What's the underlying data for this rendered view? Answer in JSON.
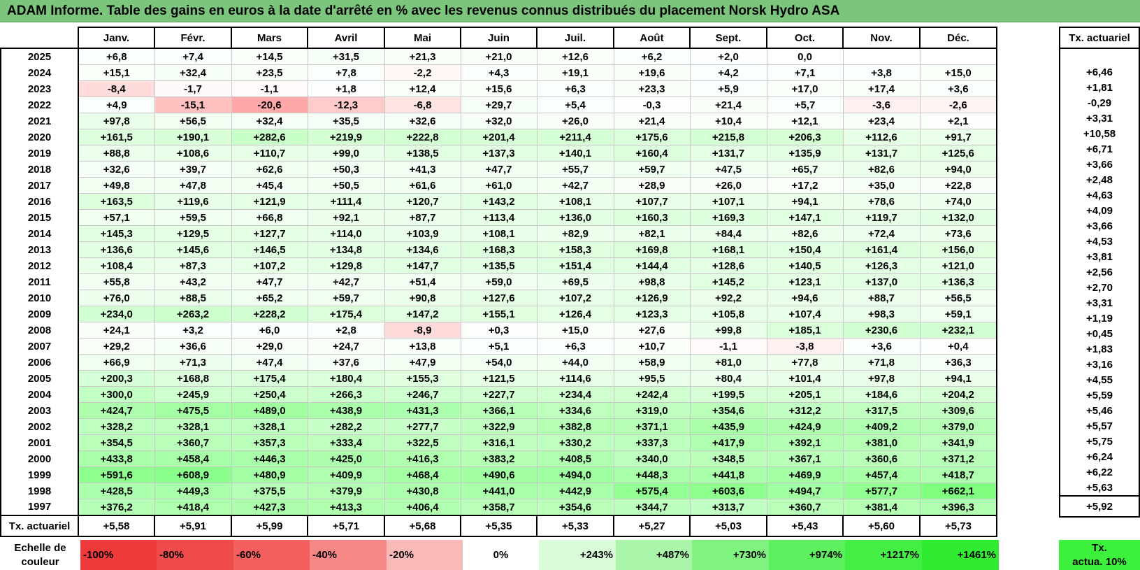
{
  "title": "ADAM Informe. Table des gains en euros à la date d'arrêté en % avec les revenus connus distribués du placement Norsk Hydro ASA",
  "months": [
    "Janv.",
    "Févr.",
    "Mars",
    "Avril",
    "Mai",
    "Juin",
    "Juil.",
    "Août",
    "Sept.",
    "Oct.",
    "Nov.",
    "Déc."
  ],
  "side_header": "Tx. actuariel",
  "rows": [
    {
      "year": "2025",
      "values": [
        "+6,8",
        "+7,4",
        "+14,5",
        "+31,5",
        "+21,3",
        "+21,0",
        "+12,6",
        "+6,2",
        "+2,0",
        "0,0",
        "",
        ""
      ],
      "rate": ""
    },
    {
      "year": "2024",
      "values": [
        "+15,1",
        "+32,4",
        "+23,5",
        "+7,8",
        "-2,2",
        "+4,3",
        "+19,1",
        "+19,6",
        "+4,2",
        "+7,1",
        "+3,8",
        "+15,0"
      ],
      "rate": "+6,46"
    },
    {
      "year": "2023",
      "values": [
        "-8,4",
        "-1,7",
        "-1,1",
        "+1,8",
        "+12,4",
        "+15,6",
        "+6,3",
        "+23,3",
        "+5,9",
        "+17,0",
        "+17,4",
        "+3,6"
      ],
      "rate": "+1,81"
    },
    {
      "year": "2022",
      "values": [
        "+4,9",
        "-15,1",
        "-20,6",
        "-12,3",
        "-6,8",
        "+29,7",
        "+5,4",
        "-0,3",
        "+21,4",
        "+5,7",
        "-3,6",
        "-2,6"
      ],
      "rate": "-0,29"
    },
    {
      "year": "2021",
      "values": [
        "+97,8",
        "+56,5",
        "+32,4",
        "+35,5",
        "+32,6",
        "+32,0",
        "+26,0",
        "+21,4",
        "+10,4",
        "+12,1",
        "+23,4",
        "+2,1"
      ],
      "rate": "+3,31"
    },
    {
      "year": "2020",
      "values": [
        "+161,5",
        "+190,1",
        "+282,6",
        "+219,9",
        "+222,8",
        "+201,4",
        "+211,4",
        "+175,6",
        "+215,8",
        "+206,3",
        "+112,6",
        "+91,7"
      ],
      "rate": "+10,58"
    },
    {
      "year": "2019",
      "values": [
        "+88,8",
        "+108,6",
        "+110,7",
        "+99,0",
        "+138,5",
        "+137,3",
        "+140,1",
        "+160,4",
        "+131,7",
        "+135,9",
        "+131,7",
        "+125,6"
      ],
      "rate": "+6,71"
    },
    {
      "year": "2018",
      "values": [
        "+32,6",
        "+39,7",
        "+62,6",
        "+50,3",
        "+41,3",
        "+47,7",
        "+55,7",
        "+59,7",
        "+47,5",
        "+65,7",
        "+82,6",
        "+94,0"
      ],
      "rate": "+3,66"
    },
    {
      "year": "2017",
      "values": [
        "+49,8",
        "+47,8",
        "+45,4",
        "+50,5",
        "+61,6",
        "+61,0",
        "+42,7",
        "+28,9",
        "+26,0",
        "+17,2",
        "+35,0",
        "+22,8"
      ],
      "rate": "+2,48"
    },
    {
      "year": "2016",
      "values": [
        "+163,5",
        "+119,6",
        "+121,9",
        "+111,4",
        "+120,7",
        "+143,2",
        "+108,1",
        "+107,7",
        "+107,1",
        "+94,1",
        "+78,6",
        "+74,0"
      ],
      "rate": "+4,63"
    },
    {
      "year": "2015",
      "values": [
        "+57,1",
        "+59,5",
        "+66,8",
        "+92,1",
        "+87,7",
        "+113,4",
        "+136,0",
        "+160,3",
        "+169,3",
        "+147,1",
        "+119,7",
        "+132,0"
      ],
      "rate": "+4,09"
    },
    {
      "year": "2014",
      "values": [
        "+145,3",
        "+129,5",
        "+127,7",
        "+114,0",
        "+103,9",
        "+108,1",
        "+82,9",
        "+82,1",
        "+84,4",
        "+82,6",
        "+72,4",
        "+73,6"
      ],
      "rate": "+3,66"
    },
    {
      "year": "2013",
      "values": [
        "+136,6",
        "+145,6",
        "+146,5",
        "+134,8",
        "+134,6",
        "+168,3",
        "+158,3",
        "+169,8",
        "+168,1",
        "+150,4",
        "+161,4",
        "+156,0"
      ],
      "rate": "+4,53"
    },
    {
      "year": "2012",
      "values": [
        "+108,4",
        "+87,3",
        "+107,2",
        "+129,8",
        "+147,7",
        "+135,5",
        "+151,4",
        "+144,4",
        "+128,6",
        "+140,5",
        "+126,3",
        "+121,0"
      ],
      "rate": "+3,81"
    },
    {
      "year": "2011",
      "values": [
        "+55,8",
        "+43,2",
        "+47,7",
        "+42,7",
        "+51,4",
        "+59,0",
        "+69,5",
        "+98,8",
        "+145,2",
        "+123,1",
        "+137,0",
        "+136,3"
      ],
      "rate": "+2,56"
    },
    {
      "year": "2010",
      "values": [
        "+76,0",
        "+88,5",
        "+65,2",
        "+59,7",
        "+90,8",
        "+127,6",
        "+107,2",
        "+126,9",
        "+92,2",
        "+94,6",
        "+88,7",
        "+56,5"
      ],
      "rate": "+2,70"
    },
    {
      "year": "2009",
      "values": [
        "+234,0",
        "+263,2",
        "+228,2",
        "+175,4",
        "+147,2",
        "+155,1",
        "+126,4",
        "+123,3",
        "+105,8",
        "+107,4",
        "+98,3",
        "+59,1"
      ],
      "rate": "+3,31"
    },
    {
      "year": "2008",
      "values": [
        "+24,1",
        "+3,2",
        "+6,0",
        "+2,8",
        "-8,9",
        "+0,3",
        "+15,0",
        "+27,6",
        "+99,8",
        "+185,1",
        "+230,6",
        "+232,1"
      ],
      "rate": "+1,19"
    },
    {
      "year": "2007",
      "values": [
        "+29,2",
        "+36,6",
        "+29,0",
        "+24,7",
        "+13,8",
        "+5,1",
        "+6,3",
        "+10,7",
        "-1,1",
        "-3,8",
        "+3,6",
        "+0,4"
      ],
      "rate": "+0,45"
    },
    {
      "year": "2006",
      "values": [
        "+66,9",
        "+71,3",
        "+47,4",
        "+37,6",
        "+47,9",
        "+54,0",
        "+44,0",
        "+58,9",
        "+81,0",
        "+77,8",
        "+71,8",
        "+36,3"
      ],
      "rate": "+1,83"
    },
    {
      "year": "2005",
      "values": [
        "+200,3",
        "+168,8",
        "+175,4",
        "+180,4",
        "+155,3",
        "+121,5",
        "+114,6",
        "+95,5",
        "+80,4",
        "+101,4",
        "+97,8",
        "+94,1"
      ],
      "rate": "+3,16"
    },
    {
      "year": "2004",
      "values": [
        "+300,0",
        "+245,9",
        "+250,4",
        "+266,3",
        "+246,7",
        "+227,7",
        "+234,4",
        "+242,4",
        "+199,5",
        "+205,1",
        "+184,6",
        "+204,2"
      ],
      "rate": "+4,55"
    },
    {
      "year": "2003",
      "values": [
        "+424,7",
        "+475,5",
        "+489,0",
        "+438,9",
        "+431,3",
        "+366,1",
        "+334,6",
        "+319,0",
        "+354,6",
        "+312,2",
        "+317,5",
        "+309,6"
      ],
      "rate": "+5,59"
    },
    {
      "year": "2002",
      "values": [
        "+328,2",
        "+328,1",
        "+328,1",
        "+282,2",
        "+277,7",
        "+322,9",
        "+382,8",
        "+371,1",
        "+435,9",
        "+424,9",
        "+409,2",
        "+379,0"
      ],
      "rate": "+5,46"
    },
    {
      "year": "2001",
      "values": [
        "+354,5",
        "+360,7",
        "+357,3",
        "+333,4",
        "+322,5",
        "+316,1",
        "+330,2",
        "+337,3",
        "+417,9",
        "+392,1",
        "+381,0",
        "+341,9"
      ],
      "rate": "+5,57"
    },
    {
      "year": "2000",
      "values": [
        "+433,8",
        "+458,4",
        "+446,3",
        "+425,0",
        "+416,3",
        "+383,2",
        "+408,5",
        "+340,0",
        "+348,5",
        "+367,1",
        "+360,6",
        "+371,2"
      ],
      "rate": "+5,75"
    },
    {
      "year": "1999",
      "values": [
        "+591,6",
        "+608,9",
        "+480,9",
        "+409,9",
        "+468,4",
        "+490,6",
        "+494,0",
        "+448,3",
        "+441,8",
        "+469,9",
        "+457,4",
        "+418,7"
      ],
      "rate": "+6,24"
    },
    {
      "year": "1998",
      "values": [
        "+428,5",
        "+449,3",
        "+375,5",
        "+379,9",
        "+430,8",
        "+441,0",
        "+442,9",
        "+575,4",
        "+603,6",
        "+494,7",
        "+577,7",
        "+662,1"
      ],
      "rate": "+6,22"
    },
    {
      "year": "1997",
      "values": [
        "+376,2",
        "+418,4",
        "+427,3",
        "+413,3",
        "+406,4",
        "+358,7",
        "+354,6",
        "+344,7",
        "+313,7",
        "+360,7",
        "+381,4",
        "+396,3"
      ],
      "rate": "+5,63"
    }
  ],
  "footer": {
    "label": "Tx. actuariel",
    "values": [
      "+5,58",
      "+5,91",
      "+5,99",
      "+5,71",
      "+5,68",
      "+5,35",
      "+5,33",
      "+5,27",
      "+5,03",
      "+5,43",
      "+5,60",
      "+5,73"
    ],
    "rate": "+5,92"
  },
  "legend": {
    "label_line1": "Echelle de",
    "label_line2": "couleur",
    "steps": [
      {
        "text": "-100%",
        "color": "#ee3a3a",
        "kind": "neg"
      },
      {
        "text": "-80%",
        "color": "#f04b4b",
        "kind": "neg"
      },
      {
        "text": "-60%",
        "color": "#f35f5f",
        "kind": "neg"
      },
      {
        "text": "-40%",
        "color": "#f68787",
        "kind": "neg"
      },
      {
        "text": "-20%",
        "color": "#f9b9b9",
        "kind": "neg"
      },
      {
        "text": "0%",
        "color": "#ffffff",
        "kind": "zero"
      },
      {
        "text": "+243%",
        "color": "#d9fbd9",
        "kind": "pos"
      },
      {
        "text": "+487%",
        "color": "#aaf5aa",
        "kind": "pos"
      },
      {
        "text": "+730%",
        "color": "#80f280",
        "kind": "pos"
      },
      {
        "text": "+974%",
        "color": "#5ef05e",
        "kind": "pos"
      },
      {
        "text": "+1217%",
        "color": "#45ee45",
        "kind": "pos"
      },
      {
        "text": "+1461%",
        "color": "#30ec30",
        "kind": "pos"
      }
    ],
    "actuarial_line1": "Tx.",
    "actuarial_line2": "actua. 10%"
  }
}
